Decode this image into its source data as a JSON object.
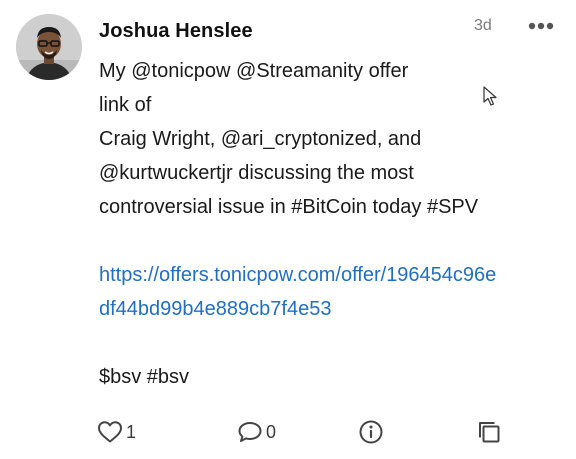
{
  "post": {
    "author": "Joshua Henslee",
    "time": "3d",
    "lines": [
      "My @tonicpow @Streamanity offer",
      "link of",
      "Craig Wright, @ari_cryptonized, and",
      "@kurtwuckertjr discussing the most",
      "controversial issue in #BitCoin today #SPV"
    ],
    "link_lines": [
      "https://offers.tonicpow.com/offer/196454c96e",
      "df44bd99b4e889cb7f4e53"
    ],
    "tags": "$bsv #bsv"
  },
  "actions": {
    "like_count": "1",
    "comment_count": "0"
  },
  "icons": {
    "more": "more-horizontal-icon",
    "like": "heart-icon",
    "comment": "speech-bubble-icon",
    "info": "info-icon",
    "copy": "copy-icon",
    "cursor": "mouse-pointer-icon"
  },
  "colors": {
    "link": "#1f6fc5",
    "text": "#1a1a1a",
    "muted": "#7a7a7a",
    "icon": "#444444"
  }
}
